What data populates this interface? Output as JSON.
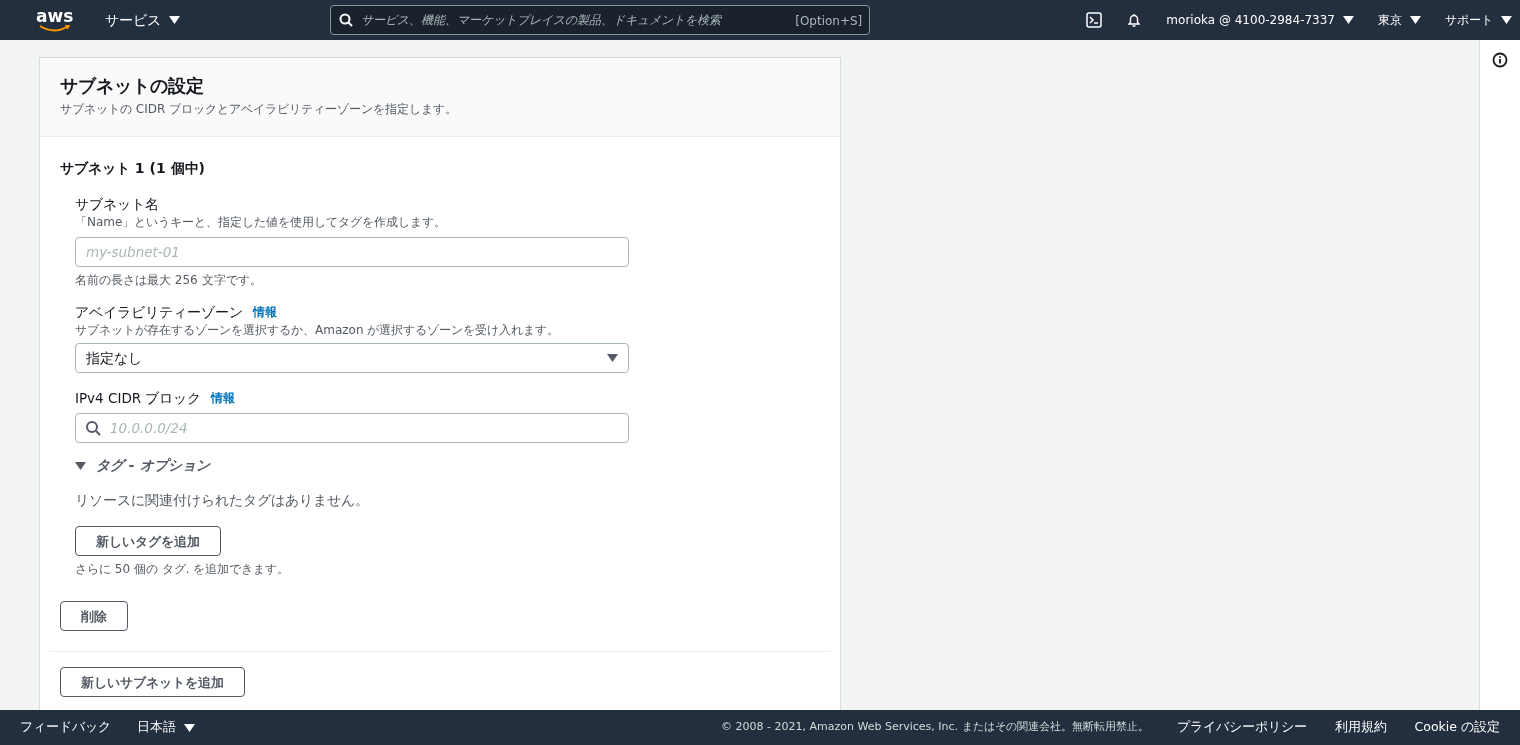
{
  "header": {
    "logo": "aws",
    "services": "サービス",
    "search": {
      "placeholder": "サービス、機能、マーケットプレイスの製品、ドキュメントを検索",
      "shortcut": "[Option+S]"
    },
    "account": "morioka @ 4100-2984-7337",
    "region": "東京",
    "support": "サポート"
  },
  "panel": {
    "title": "サブネットの設定",
    "description": "サブネットの CIDR ブロックとアベイラビリティーゾーンを指定します。",
    "subnet_heading": "サブネット 1 (1 個中)",
    "name_field": {
      "label": "サブネット名",
      "hint": "「Name」というキーと、指定した値を使用してタグを作成します。",
      "placeholder": "my-subnet-01",
      "note": "名前の長さは最大 256 文字です。"
    },
    "az_field": {
      "label": "アベイラビリティーゾーン",
      "info": "情報",
      "hint": "サブネットが存在するゾーンを選択するか、Amazon が選択するゾーンを受け入れます。",
      "value": "指定なし"
    },
    "cidr_field": {
      "label": "IPv4 CIDR ブロック",
      "info": "情報",
      "placeholder": "10.0.0.0/24"
    },
    "tags": {
      "title": "タグ - オプション",
      "expanded": true,
      "empty": "リソースに関連付けられたタグはありません。",
      "add_button": "新しいタグを追加",
      "note": "さらに 50 個の タグ. を追加できます。"
    },
    "delete_button": "削除",
    "add_subnet_button": "新しいサブネットを追加"
  },
  "footer": {
    "feedback": "フィードバック",
    "language": "日本語",
    "copyright": "© 2008 - 2021, Amazon Web Services, Inc. またはその関連会社。無断転用禁止。",
    "links": [
      "プライバシーポリシー",
      "利用規約",
      "Cookie の設定"
    ]
  }
}
